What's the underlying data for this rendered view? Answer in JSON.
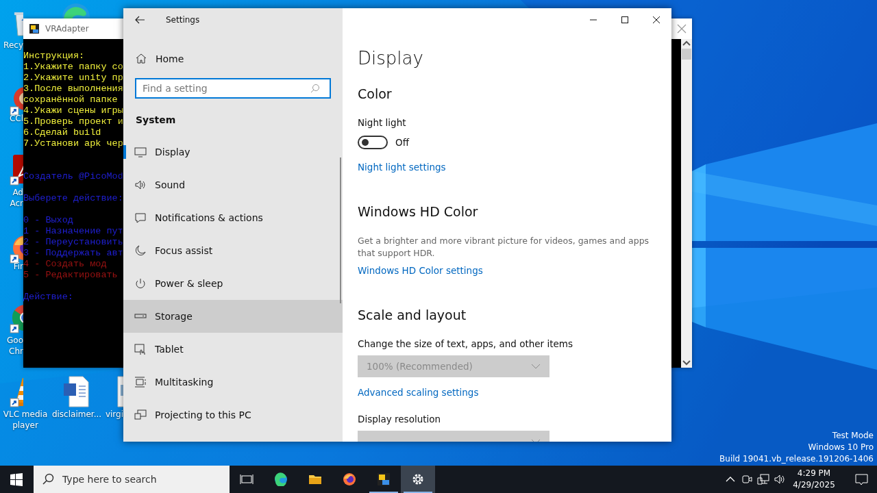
{
  "desktop": {
    "icons": [
      {
        "label": [
          "Recy"
        ],
        "shortcut": false
      },
      {
        "label": [
          "CCl"
        ],
        "shortcut": true
      },
      {
        "label": [
          "Ad",
          "Acr"
        ],
        "shortcut": true
      },
      {
        "label": [
          "Fir"
        ],
        "shortcut": true
      },
      {
        "label": [
          "Goo",
          "Chr"
        ],
        "shortcut": true
      },
      {
        "label": [
          "VLC media",
          "player"
        ],
        "shortcut": true
      },
      {
        "label": [
          "disclaimer..."
        ],
        "shortcut": false
      },
      {
        "label": [
          "virgi"
        ],
        "shortcut": false
      }
    ],
    "system_info": [
      "Test Mode",
      "Windows 10 Pro",
      "Build 19041.vb_release.191206-1406"
    ]
  },
  "console_window": {
    "title": "VRAdapter",
    "blocks": [
      [
        {
          "text": "Инструкция:",
          "color": "#f2f23c"
        },
        {
          "text": "1.Укажите папку со",
          "color": "#f2f23c"
        },
        {
          "text": "2.Укажите unity пр",
          "color": "#f2f23c"
        },
        {
          "text": "3.После выполнения",
          "color": "#f2f23c"
        },
        {
          "text": "сохранённой папке",
          "color": "#f2f23c"
        },
        {
          "text": "4.Укажи сцены игры",
          "color": "#f2f23c"
        },
        {
          "text": "5.Проверь проект и",
          "color": "#f2f23c"
        },
        {
          "text": "6.Сделай build",
          "color": "#f2f23c"
        },
        {
          "text": "7.Установи apk чер",
          "color": "#f2f23c"
        }
      ],
      [
        {
          "text": "Создатель @PicoMod",
          "color": "#1f1fd2"
        }
      ],
      [
        {
          "text": "Выберете действие:",
          "color": "#1f1fd2"
        }
      ],
      [
        {
          "text": "0 - Выход",
          "color": "#1f1fd2"
        },
        {
          "text": "1 - Назначение пут",
          "color": "#1f1fd2"
        },
        {
          "text": "2 - Переустановить",
          "color": "#1f1fd2"
        },
        {
          "text": "3 - Поддержать авт",
          "color": "#1f1fd2"
        },
        {
          "text": "4 - Создать мод",
          "color": "#9a1212"
        },
        {
          "text": "5 - Редактировать",
          "color": "#9a1212"
        }
      ],
      [
        {
          "text": "Действие:",
          "color": "#1f1fd2"
        }
      ]
    ]
  },
  "settings_window": {
    "title": "Settings",
    "home": "Home",
    "search": {
      "placeholder": "Find a setting"
    },
    "section": "System",
    "nav": [
      {
        "label": "Display",
        "selected": true,
        "highlighted": false
      },
      {
        "label": "Sound",
        "selected": false,
        "highlighted": false
      },
      {
        "label": "Notifications & actions",
        "selected": false,
        "highlighted": false
      },
      {
        "label": "Focus assist",
        "selected": false,
        "highlighted": false
      },
      {
        "label": "Power & sleep",
        "selected": false,
        "highlighted": false
      },
      {
        "label": "Storage",
        "selected": false,
        "highlighted": true
      },
      {
        "label": "Tablet",
        "selected": false,
        "highlighted": false
      },
      {
        "label": "Multitasking",
        "selected": false,
        "highlighted": false
      },
      {
        "label": "Projecting to this PC",
        "selected": false,
        "highlighted": false
      }
    ],
    "page": {
      "title": "Display",
      "sections": [
        {
          "heading": "Color",
          "items": [
            {
              "kind": "toggle",
              "label": "Night light",
              "on": false,
              "state_text": "Off"
            },
            {
              "kind": "link",
              "text": "Night light settings"
            }
          ]
        },
        {
          "heading": "Windows HD Color",
          "items": [
            {
              "kind": "text",
              "text": "Get a brighter and more vibrant picture for videos, games and apps that support HDR."
            },
            {
              "kind": "link",
              "text": "Windows HD Color settings"
            }
          ]
        },
        {
          "heading": "Scale and layout",
          "items": [
            {
              "kind": "dropdown",
              "label": "Change the size of text, apps, and other items",
              "value": "100% (Recommended)",
              "disabled": true
            },
            {
              "kind": "link",
              "text": "Advanced scaling settings"
            },
            {
              "kind": "dropdown",
              "label": "Display resolution",
              "disabled": true
            }
          ]
        }
      ]
    }
  },
  "taskbar": {
    "search_placeholder": "Type here to search",
    "apps": [
      {
        "open": false,
        "active": false
      },
      {
        "open": false,
        "active": false
      },
      {
        "open": false,
        "active": false
      },
      {
        "open": false,
        "active": false
      },
      {
        "open": true,
        "active": false
      },
      {
        "open": true,
        "active": true
      }
    ],
    "time": "4:29 PM",
    "date": "4/29/2025"
  }
}
